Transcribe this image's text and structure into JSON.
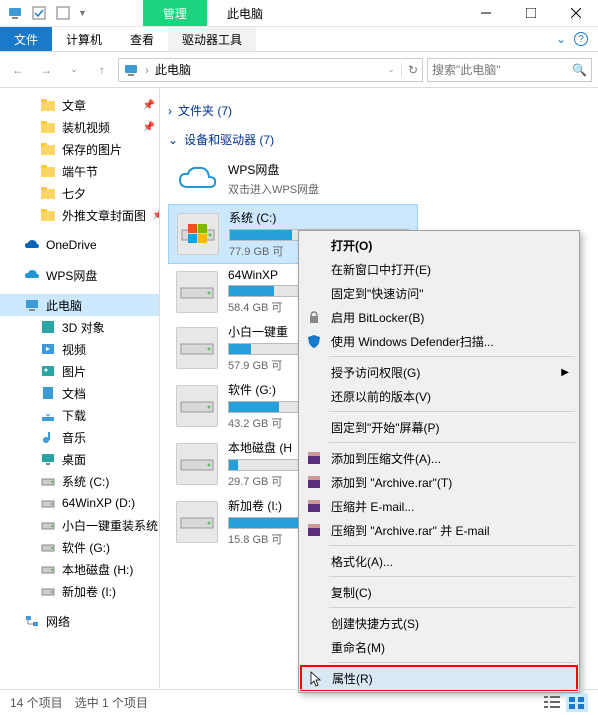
{
  "titlebar": {
    "manage_tab": "管理",
    "window_title": "此电脑"
  },
  "ribbon": {
    "file": "文件",
    "computer": "计算机",
    "view": "查看",
    "drive_tools": "驱动器工具"
  },
  "nav": {
    "location": "此电脑",
    "search_placeholder": "搜索\"此电脑\""
  },
  "tree": {
    "items": [
      {
        "label": "文章",
        "icon": "folder",
        "lvl": 1,
        "pin": true
      },
      {
        "label": "装机视频",
        "icon": "folder",
        "lvl": 1,
        "pin": true
      },
      {
        "label": "保存的图片",
        "icon": "folder",
        "lvl": 1
      },
      {
        "label": "端午节",
        "icon": "folder",
        "lvl": 1
      },
      {
        "label": "七夕",
        "icon": "folder",
        "lvl": 1
      },
      {
        "label": "外推文章封面图",
        "icon": "folder",
        "lvl": 1,
        "pin": true
      },
      {
        "label": "OneDrive",
        "icon": "onedrive",
        "lvl": 0
      },
      {
        "label": "WPS网盘",
        "icon": "wps",
        "lvl": 0
      },
      {
        "label": "此电脑",
        "icon": "pc",
        "lvl": 0,
        "sel": true
      },
      {
        "label": "3D 对象",
        "icon": "3d",
        "lvl": 1
      },
      {
        "label": "视频",
        "icon": "video",
        "lvl": 1
      },
      {
        "label": "图片",
        "icon": "pictures",
        "lvl": 1
      },
      {
        "label": "文档",
        "icon": "docs",
        "lvl": 1
      },
      {
        "label": "下载",
        "icon": "downloads",
        "lvl": 1
      },
      {
        "label": "音乐",
        "icon": "music",
        "lvl": 1
      },
      {
        "label": "桌面",
        "icon": "desktop",
        "lvl": 1
      },
      {
        "label": "系统 (C:)",
        "icon": "drive",
        "lvl": 1
      },
      {
        "label": "64WinXP  (D:)",
        "icon": "drive",
        "lvl": 1
      },
      {
        "label": "小白一键重装系统",
        "icon": "drive",
        "lvl": 1
      },
      {
        "label": "软件 (G:)",
        "icon": "drive",
        "lvl": 1
      },
      {
        "label": "本地磁盘 (H:)",
        "icon": "drive",
        "lvl": 1
      },
      {
        "label": "新加卷 (I:)",
        "icon": "drive",
        "lvl": 1
      },
      {
        "label": "网络",
        "icon": "network",
        "lvl": 0
      }
    ]
  },
  "main": {
    "folders_header": "文件夹 (7)",
    "devices_header": "设备和驱动器 (7)",
    "wps": {
      "name": "WPS网盘",
      "sub": "双击进入WPS网盘"
    },
    "drives": [
      {
        "name": "系统 (C:)",
        "sub": "77.9 GB 可",
        "fill": 35,
        "sel": true,
        "logo": true
      },
      {
        "name": "64WinXP",
        "sub": "58.4 GB 可",
        "fill": 25
      },
      {
        "name": "小白一键重",
        "sub": "57.9 GB 可",
        "fill": 12
      },
      {
        "name": "软件 (G:)",
        "sub": "43.2 GB 可",
        "fill": 28
      },
      {
        "name": "本地磁盘 (H",
        "sub": "29.7 GB 可",
        "fill": 5
      },
      {
        "name": "新加卷 (I:)",
        "sub": "15.8 GB 可",
        "fill": 70
      }
    ]
  },
  "context_menu": {
    "items": [
      {
        "label": "打开(O)",
        "bold": true
      },
      {
        "label": "在新窗口中打开(E)"
      },
      {
        "label": "固定到\"快速访问\""
      },
      {
        "label": "启用 BitLocker(B)",
        "icon": "bitlocker"
      },
      {
        "label": "使用 Windows Defender扫描...",
        "icon": "defender"
      },
      {
        "sep": true
      },
      {
        "label": "授予访问权限(G)",
        "arrow": true
      },
      {
        "label": "还原以前的版本(V)"
      },
      {
        "sep": true
      },
      {
        "label": "固定到\"开始\"屏幕(P)"
      },
      {
        "sep": true
      },
      {
        "label": "添加到压缩文件(A)...",
        "icon": "rar"
      },
      {
        "label": "添加到 \"Archive.rar\"(T)",
        "icon": "rar"
      },
      {
        "label": "压缩并 E-mail...",
        "icon": "rar"
      },
      {
        "label": "压缩到 \"Archive.rar\" 并 E-mail",
        "icon": "rar"
      },
      {
        "sep": true
      },
      {
        "label": "格式化(A)..."
      },
      {
        "sep": true
      },
      {
        "label": "复制(C)"
      },
      {
        "sep": true
      },
      {
        "label": "创建快捷方式(S)"
      },
      {
        "label": "重命名(M)"
      },
      {
        "sep": true
      },
      {
        "label": "属性(R)",
        "hl": true,
        "hover": true
      }
    ]
  },
  "statusbar": {
    "items": "14 个项目",
    "selected": "选中 1 个项目"
  }
}
